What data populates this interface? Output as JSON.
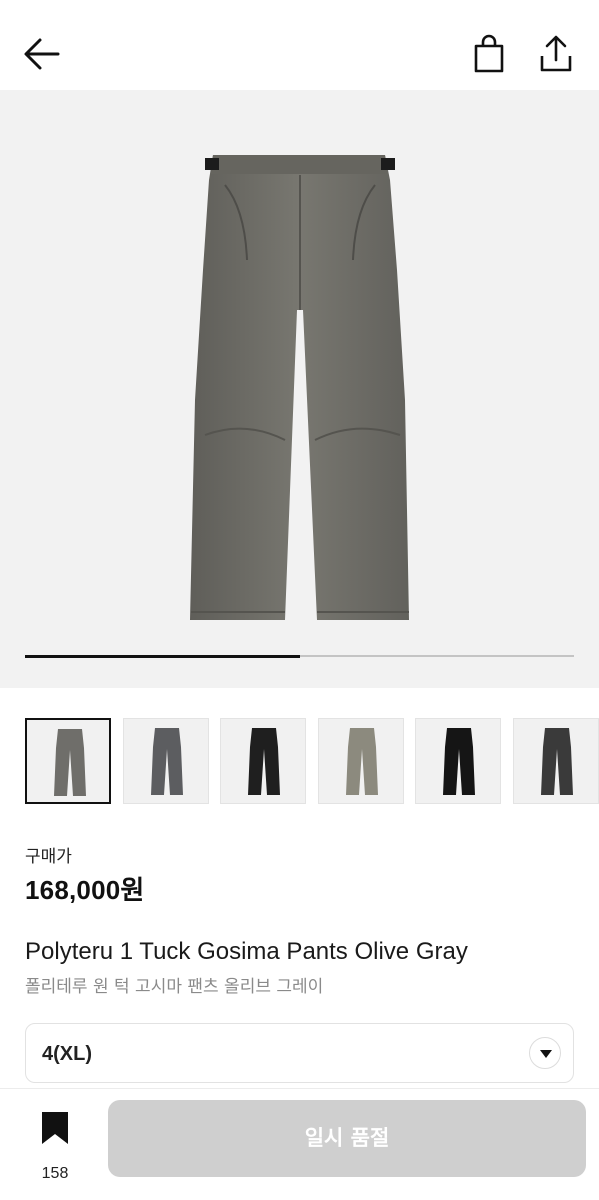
{
  "header": {
    "back_icon": "arrow-left-icon",
    "bag_icon": "shopping-bag-icon",
    "share_icon": "share-icon"
  },
  "gallery": {
    "main_image": "gray-wide-pants-image",
    "progress": 0.5,
    "thumbnails": [
      {
        "color": "#6f6e6a",
        "selected": true
      },
      {
        "color": "#5c5d60",
        "selected": false
      },
      {
        "color": "#1f1f1f",
        "selected": false
      },
      {
        "color": "#8c8a7e",
        "selected": false
      },
      {
        "color": "#151515",
        "selected": false
      },
      {
        "color": "#3a3a3a",
        "selected": false
      }
    ]
  },
  "product": {
    "price_label": "구매가",
    "price": "168,000원",
    "name_en": "Polyteru 1 Tuck Gosima Pants Olive Gray",
    "name_ko": "폴리테루 원 턱 고시마 팬츠 올리브 그레이"
  },
  "size_select": {
    "value": "4(XL)",
    "icon": "chevron-down-icon"
  },
  "bottom_bar": {
    "bookmark_icon": "bookmark-icon",
    "bookmark_count": "158",
    "action_label": "일시 품절"
  },
  "colors": {
    "accent": "#111111",
    "disabled_button": "#cfcfcf"
  }
}
